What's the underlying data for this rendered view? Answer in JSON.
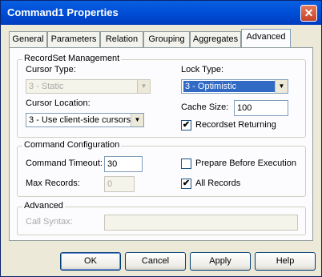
{
  "window": {
    "title": "Command1 Properties",
    "close_glyph": "✕"
  },
  "tabs": [
    {
      "label": "General"
    },
    {
      "label": "Parameters"
    },
    {
      "label": "Relation"
    },
    {
      "label": "Grouping"
    },
    {
      "label": "Aggregates"
    },
    {
      "label": "Advanced"
    }
  ],
  "recordset": {
    "title": "RecordSet Management",
    "cursor_type_label": "Cursor Type:",
    "cursor_type_value": "3 - Static",
    "lock_type_label": "Lock Type:",
    "lock_type_value": "3 - Optimistic",
    "cursor_location_label": "Cursor Location:",
    "cursor_location_value": "3 - Use client-side cursors",
    "cache_size_label": "Cache Size:",
    "cache_size_value": "100",
    "recordset_returning_label": "Recordset Returning",
    "recordset_returning_checked": true
  },
  "command": {
    "title": "Command Configuration",
    "timeout_label": "Command Timeout:",
    "timeout_value": "30",
    "prepare_label": "Prepare Before Execution",
    "prepare_checked": false,
    "max_records_label": "Max Records:",
    "max_records_value": "0",
    "all_records_label": "All Records",
    "all_records_checked": true
  },
  "advanced": {
    "title": "Advanced",
    "call_syntax_label": "Call Syntax:",
    "call_syntax_value": ""
  },
  "buttons": {
    "ok": "OK",
    "cancel": "Cancel",
    "apply": "Apply",
    "help": "Help"
  },
  "glyphs": {
    "check": "✔",
    "dropdown": "▼"
  }
}
